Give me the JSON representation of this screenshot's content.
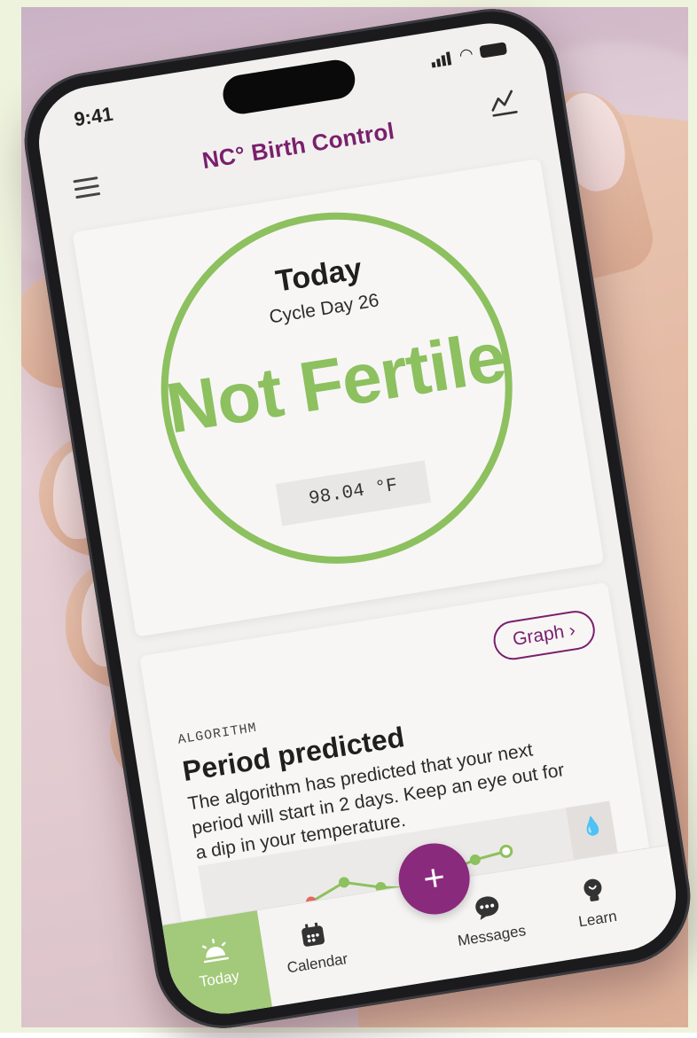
{
  "status_bar": {
    "time": "9:41"
  },
  "header": {
    "title": "NC° Birth Control"
  },
  "today_card": {
    "heading": "Today",
    "cycle_day": "Cycle Day 26",
    "status": "Not Fertile",
    "temperature": "98.04 °F"
  },
  "algorithm_card": {
    "graph_button": "Graph ›",
    "eyebrow": "ALGORITHM",
    "title": "Period predicted",
    "body": "The algorithm has predicted that your next period will start in 2 days. Keep an eye out for a dip in your temperature."
  },
  "tabs": {
    "today": "Today",
    "calendar": "Calendar",
    "add": "+",
    "messages": "Messages",
    "learn": "Learn"
  },
  "colors": {
    "brand_purple": "#7a1f6c",
    "fertile_status_green": "#8dc05f",
    "active_tab_green": "#a3c97a",
    "period_red": "#e06a5e"
  },
  "icons": [
    "menu-icon",
    "graph-trend-icon",
    "sun-icon",
    "calendar-icon",
    "plus-icon",
    "chat-bubble-icon",
    "lightbulb-icon",
    "drops-icon"
  ]
}
